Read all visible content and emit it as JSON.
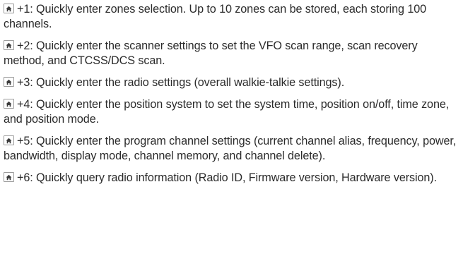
{
  "entries": [
    {
      "icon": "home-key-icon",
      "text": "+1: Quickly enter zones selection. Up to 10 zones can be stored, each storing 100 channels."
    },
    {
      "icon": "home-key-icon",
      "text": "+2: Quickly enter the scanner settings to set the VFO scan range, scan recovery method, and CTCSS/DCS scan."
    },
    {
      "icon": "home-key-icon",
      "text": "+3: Quickly enter the radio settings (overall walkie-talkie settings)."
    },
    {
      "icon": "home-key-icon",
      "text": "+4: Quickly enter the position system to set the system time, position on/off, time zone, and position mode."
    },
    {
      "icon": "home-key-icon",
      "text": "+5: Quickly enter the program channel settings (current channel alias, frequency, power, bandwidth, display mode, channel memory, and channel delete)."
    },
    {
      "icon": "home-key-icon",
      "text": "+6: Quickly query radio information (Radio ID, Firmware version, Hardware version)."
    }
  ]
}
